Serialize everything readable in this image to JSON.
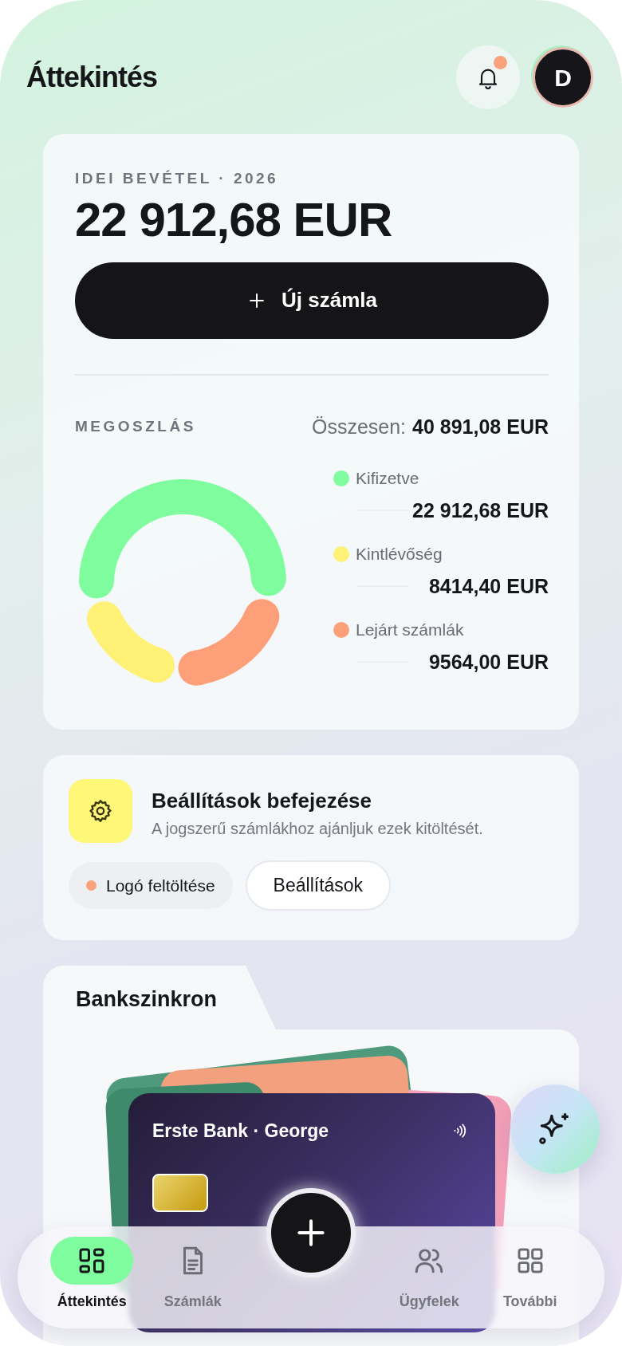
{
  "header": {
    "title": "Áttekintés",
    "notification": {
      "unread": true
    },
    "avatar": {
      "initial": "D"
    }
  },
  "revenue_card": {
    "label": "IDEI BEVÉTEL · 2026",
    "amount": "22 912,68 EUR",
    "new_invoice_button": "Új számla"
  },
  "distribution": {
    "title": "MEGOSZLÁS",
    "total_label": "Összesen:",
    "total_value": "40 891,08 EUR",
    "chart_data": {
      "type": "donut",
      "categories": [
        "Kifizetve",
        "Kintlévőség",
        "Lejárt számlák"
      ],
      "values": [
        56.03,
        20.58,
        23.39
      ]
    },
    "legend": [
      {
        "value": "22 912,68 EUR",
        "color": "#7ffc9e"
      },
      {
        "value": "8414,40 EUR",
        "color": "#fff176"
      },
      {
        "value": "9564,00 EUR",
        "color": "#fda07a"
      }
    ]
  },
  "setup_card": {
    "title": "Beállítások befejezése",
    "description": "A jogszerű számlákhoz ajánljuk ezek kitöltését.",
    "chip": "Logó feltöltése",
    "button": "Beállítások"
  },
  "bank_sync": {
    "tab": "Bankszinkron",
    "card": {
      "bank": "Erste Bank · George"
    }
  },
  "bottom_nav": {
    "items": [
      {
        "label": "Áttekintés",
        "kind": "dashboard",
        "selected": true
      },
      {
        "label": "Számlák",
        "kind": "document",
        "selected": false
      },
      {
        "label": "Ügyfelek",
        "kind": "people",
        "selected": false
      },
      {
        "label": "További",
        "kind": "apps",
        "selected": false
      }
    ]
  }
}
